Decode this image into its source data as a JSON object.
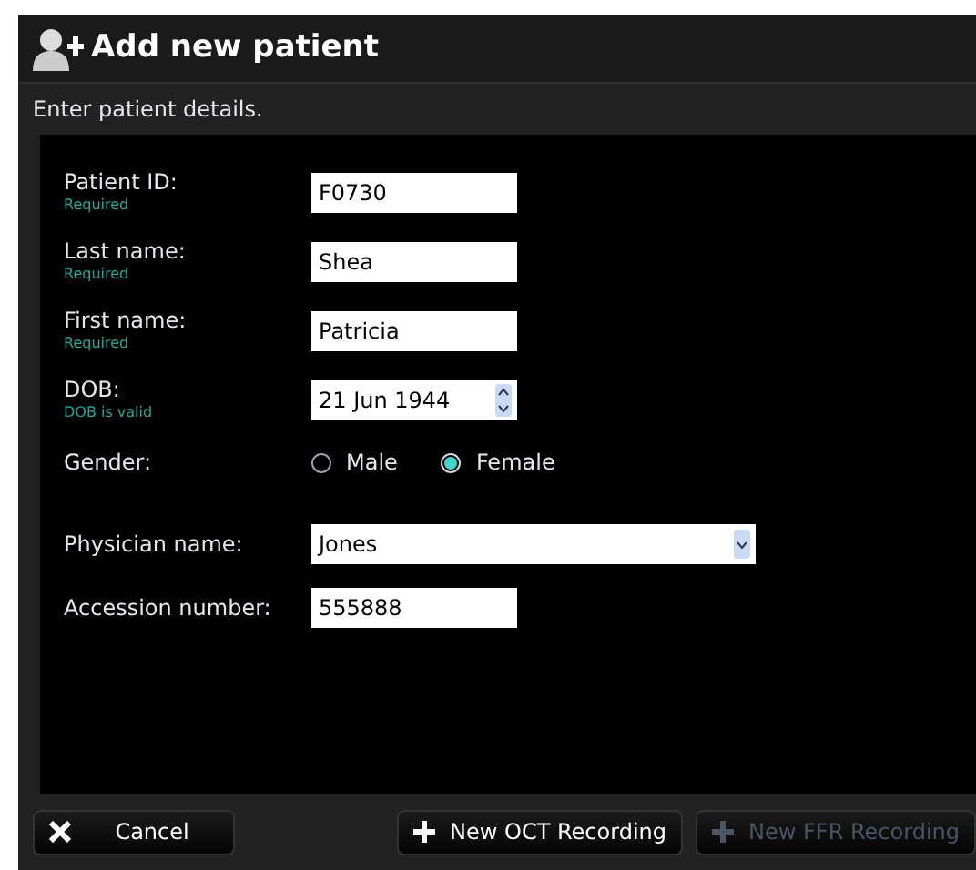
{
  "window": {
    "title": "Add new patient"
  },
  "subtitle": "Enter patient details.",
  "fields": [
    {
      "kind": "text",
      "label": "Patient ID:",
      "hint": "Required",
      "value": "F0730"
    },
    {
      "kind": "text",
      "label": "Last name:",
      "hint": "Required",
      "value": "Shea"
    },
    {
      "kind": "text",
      "label": "First name:",
      "hint": "Required",
      "value": "Patricia"
    },
    {
      "kind": "date",
      "label": "DOB:",
      "hint": "DOB is valid",
      "value": "21 Jun 1944"
    },
    {
      "kind": "radio",
      "label": "Gender:",
      "options": [
        {
          "label": "Male",
          "selected": false
        },
        {
          "label": "Female",
          "selected": true
        }
      ]
    },
    {
      "kind": "select",
      "label": "Physician name:",
      "value": "Jones"
    },
    {
      "kind": "text",
      "label": "Accession number:",
      "value": "555888"
    }
  ],
  "buttons": [
    {
      "kind": "cancel",
      "label": "Cancel",
      "disabled": false
    },
    {
      "kind": "add",
      "label": "New OCT Recording",
      "disabled": false
    },
    {
      "kind": "add",
      "label": "New FFR Recording",
      "disabled": true
    }
  ]
}
